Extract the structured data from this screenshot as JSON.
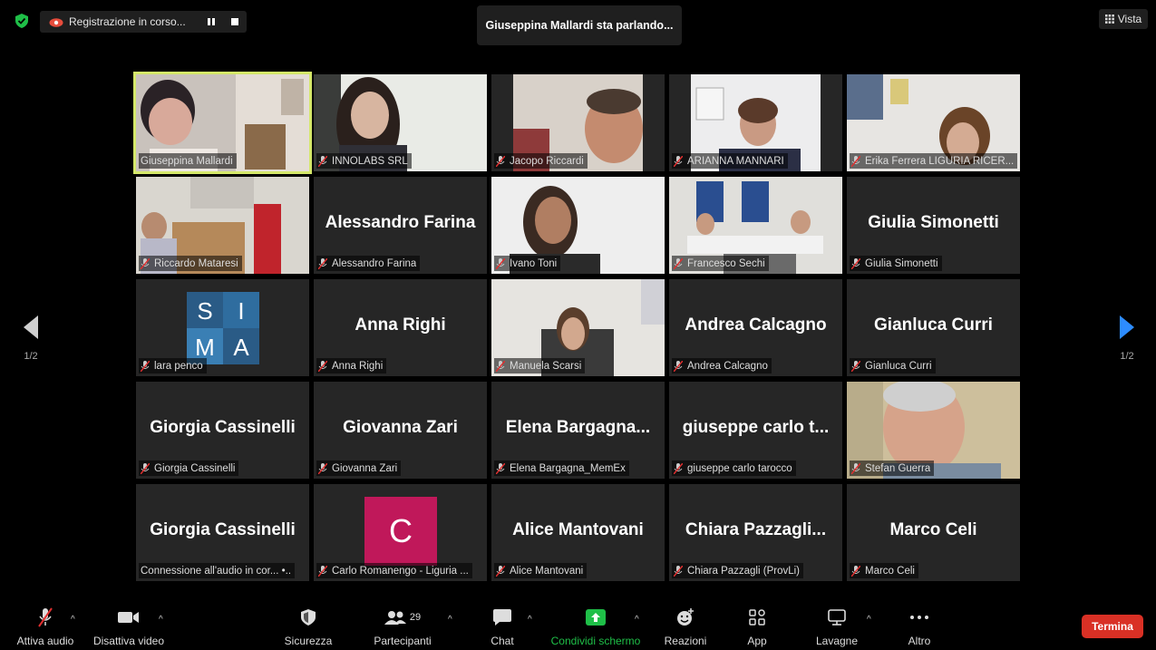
{
  "top": {
    "recording_text": "Registrazione in corso...",
    "speaking_text": "Giuseppina Mallardi sta parlando...",
    "view_label": "Vista"
  },
  "pages": {
    "left": "1/2",
    "right": "1/2"
  },
  "tiles": [
    {
      "big": "",
      "label": "Giuseppina Mallardi"
    },
    {
      "big": "",
      "label": "INNOLABS SRL"
    },
    {
      "big": "",
      "label": "Jacopo Riccardi"
    },
    {
      "big": "",
      "label": "ARIANNA MANNARI"
    },
    {
      "big": "",
      "label": "Erika Ferrera LIGURIA RICER..."
    },
    {
      "big": "",
      "label": "Riccardo Mataresi"
    },
    {
      "big": "Alessandro Farina",
      "label": "Alessandro Farina"
    },
    {
      "big": "",
      "label": "Ivano Toni"
    },
    {
      "big": "",
      "label": "Francesco Sechi"
    },
    {
      "big": "Giulia Simonetti",
      "label": "Giulia Simonetti"
    },
    {
      "big": "",
      "label": "lara penco",
      "logo_letters": [
        "S",
        "I",
        "M",
        "A"
      ]
    },
    {
      "big": "Anna Righi",
      "label": "Anna Righi"
    },
    {
      "big": "",
      "label": "Manuela Scarsi"
    },
    {
      "big": "Andrea Calcagno",
      "label": "Andrea Calcagno"
    },
    {
      "big": "Gianluca Curri",
      "label": "Gianluca Curri"
    },
    {
      "big": "Giorgia Cassinelli",
      "label": "Giorgia Cassinelli"
    },
    {
      "big": "Giovanna Zari",
      "label": "Giovanna Zari"
    },
    {
      "big": "Elena  Bargagna...",
      "label": "Elena Bargagna_MemEx"
    },
    {
      "big": "giuseppe  carlo  t...",
      "label": "giuseppe carlo tarocco"
    },
    {
      "big": "",
      "label": "Stefan Guerra"
    },
    {
      "big": "Giorgia Cassinelli",
      "label": "Connessione all'audio in cor... •.."
    },
    {
      "big": "",
      "label": "Carlo Romanengo - Liguria ...",
      "avatar_letter": "C"
    },
    {
      "big": "Alice Mantovani",
      "label": "Alice Mantovani"
    },
    {
      "big": "Chiara  Pazzagli...",
      "label": "Chiara Pazzagli (ProvLi)"
    },
    {
      "big": "Marco Celi",
      "label": "Marco Celi"
    }
  ],
  "toolbar": {
    "audio": "Attiva audio",
    "video": "Disattiva video",
    "security": "Sicurezza",
    "participants": "Partecipanti",
    "participants_count": "29",
    "chat": "Chat",
    "share": "Condividi schermo",
    "reactions": "Reazioni",
    "apps": "App",
    "whiteboards": "Lavagne",
    "more": "Altro",
    "end": "Termina"
  },
  "colors": {
    "active_border": "#d5e86a",
    "share_green": "#1fbf48",
    "end_red": "#d93025",
    "nav_arrow_right": "#2d8cff"
  }
}
